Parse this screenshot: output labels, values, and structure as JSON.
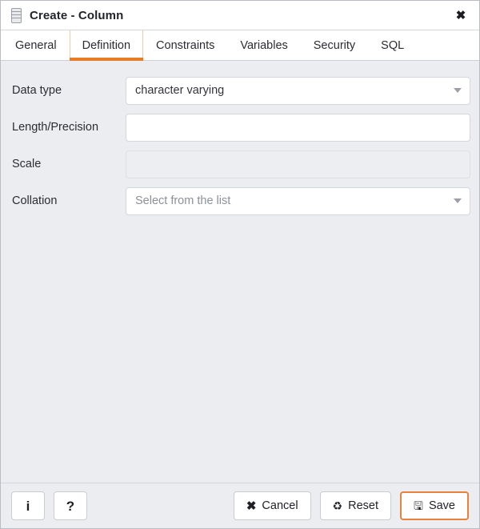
{
  "dialog": {
    "title": "Create - Column",
    "icon": "column-icon",
    "close_label": "✖"
  },
  "tabs": [
    {
      "label": "General",
      "active": false
    },
    {
      "label": "Definition",
      "active": true
    },
    {
      "label": "Constraints",
      "active": false
    },
    {
      "label": "Variables",
      "active": false
    },
    {
      "label": "Security",
      "active": false
    },
    {
      "label": "SQL",
      "active": false
    }
  ],
  "form": {
    "data_type": {
      "label": "Data type",
      "value": "character varying",
      "control": "select"
    },
    "length_precision": {
      "label": "Length/Precision",
      "value": "",
      "placeholder": "",
      "control": "text"
    },
    "scale": {
      "label": "Scale",
      "value": "",
      "placeholder": "",
      "control": "text",
      "disabled": true
    },
    "collation": {
      "label": "Collation",
      "value": "",
      "placeholder": "Select from the list",
      "control": "select"
    }
  },
  "footer": {
    "info_label": "i",
    "help_label": "?",
    "cancel_label": "Cancel",
    "cancel_glyph": "✖",
    "reset_label": "Reset",
    "reset_glyph": "♻",
    "save_label": "Save",
    "save_glyph": "🖫"
  },
  "colors": {
    "accent": "#e87c26",
    "dialog_bg": "#ebedf0",
    "panel_bg": "#ffffff",
    "border": "#d3d6dc",
    "text": "#2b2d33",
    "placeholder": "#8c9099",
    "disabled_bg": "#eceef2"
  }
}
